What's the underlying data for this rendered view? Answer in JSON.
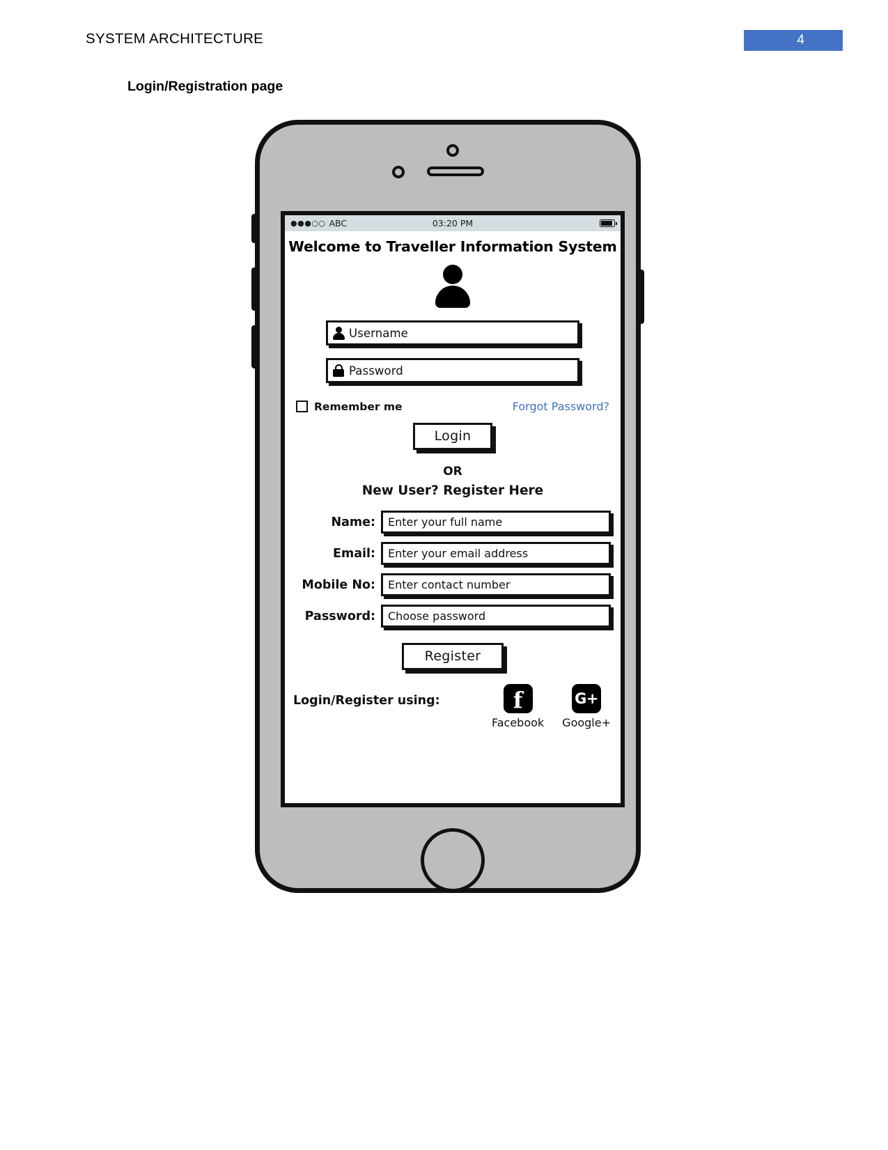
{
  "document": {
    "header_title": "SYSTEM ARCHITECTURE",
    "page_number": "4",
    "page_badge_color": "#4472c4",
    "section_caption": "Login/Registration page"
  },
  "phone": {
    "status_bar": {
      "signal_dots": "●●●○○",
      "carrier": "ABC",
      "time": "03:20 PM",
      "battery_icon": "battery-icon"
    },
    "screen": {
      "welcome_title": "Welcome to Traveller Information System",
      "avatar_icon": "user-avatar-icon",
      "login": {
        "username": {
          "placeholder": "Username",
          "icon": "person-icon"
        },
        "password": {
          "placeholder": "Password",
          "icon": "lock-icon"
        },
        "remember_me_label": "Remember me",
        "forgot_password_label": "Forgot Password?",
        "forgot_password_color": "#3f74c4",
        "login_button_label": "Login"
      },
      "divider_text": "OR",
      "register_prompt": "New User?  Register Here",
      "registration_fields": [
        {
          "label": "Name:",
          "placeholder": "Enter your full name"
        },
        {
          "label": "Email:",
          "placeholder": "Enter your email address"
        },
        {
          "label": "Mobile No:",
          "placeholder": "Enter contact number"
        },
        {
          "label": "Password:",
          "placeholder": "Choose password"
        }
      ],
      "register_button_label": "Register",
      "social": {
        "label": "Login/Register using:",
        "providers": [
          {
            "name": "Facebook",
            "glyph": "f",
            "icon": "facebook-icon"
          },
          {
            "name": "Google+",
            "glyph": "G+",
            "icon": "google-plus-icon"
          }
        ]
      }
    }
  }
}
